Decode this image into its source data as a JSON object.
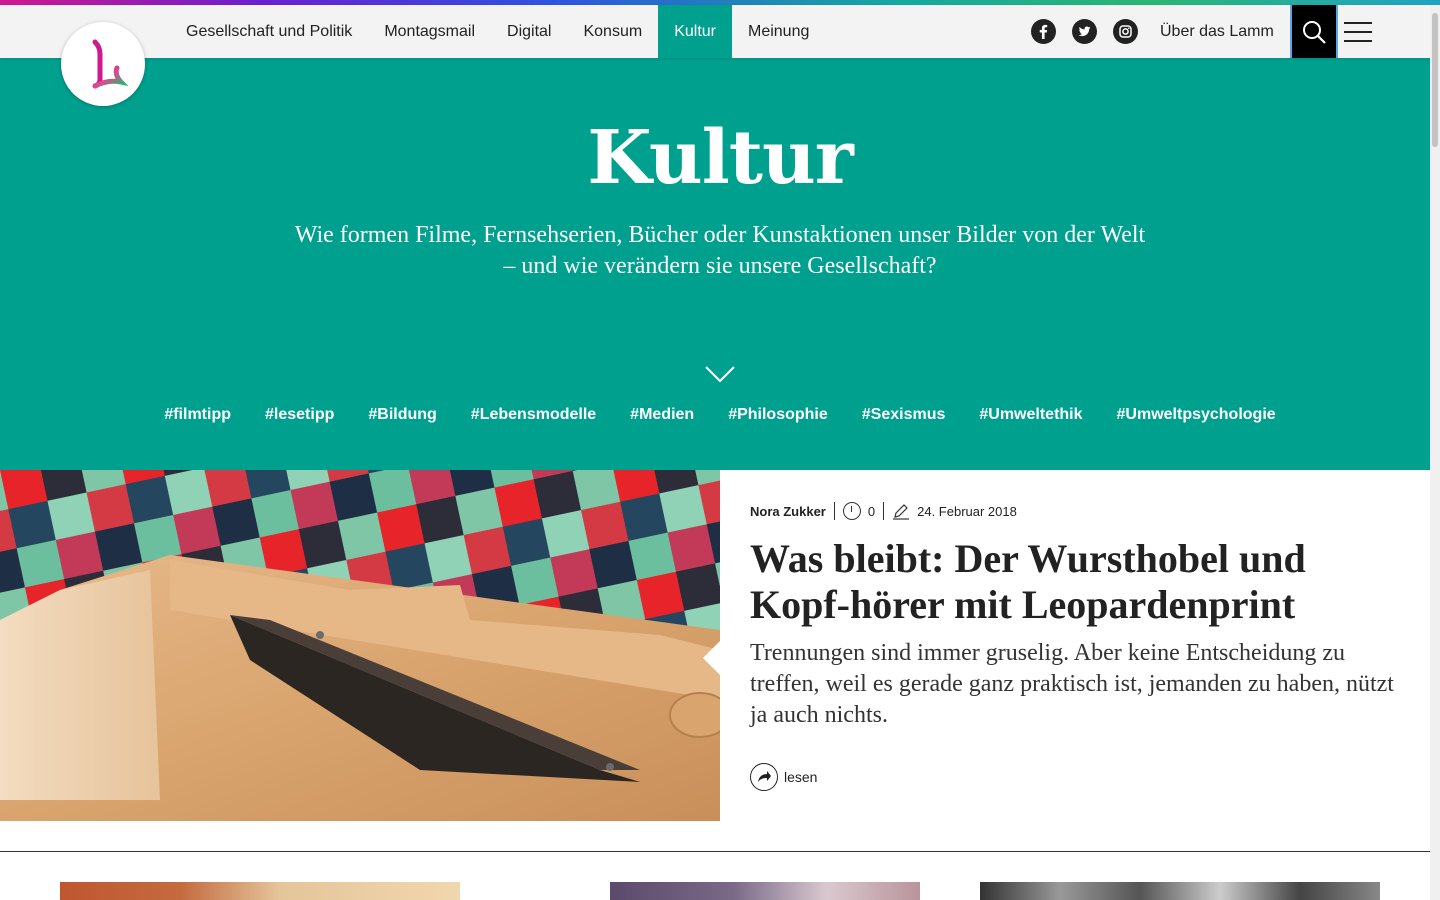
{
  "nav": {
    "items": [
      {
        "label": "Gesellschaft und Politik",
        "active": false
      },
      {
        "label": "Montagsmail",
        "active": false
      },
      {
        "label": "Digital",
        "active": false
      },
      {
        "label": "Konsum",
        "active": false
      },
      {
        "label": "Kultur",
        "active": true
      },
      {
        "label": "Meinung",
        "active": false
      }
    ],
    "about_label": "Über das Lamm",
    "social_icons": [
      "facebook-icon",
      "twitter-icon",
      "instagram-icon"
    ],
    "logo_letter": "L"
  },
  "hero": {
    "title": "Kultur",
    "subtitle_line1": "Wie formen Filme, Fernsehserien, Bücher oder Kunstaktionen unser Bilder von der Welt",
    "subtitle_line2": "– und wie verändern sie unsere Gesellschaft?",
    "tags": [
      "#filmtipp",
      "#lesetipp",
      "#Bildung",
      "#Lebensmodelle",
      "#Medien",
      "#Philosophie",
      "#Sexismus",
      "#Umweltethik",
      "#Umweltpsychologie"
    ],
    "background_color": "#00a08f"
  },
  "featured": {
    "author": "Nora Zukker",
    "comments": "0",
    "date": "24. Februar 2018",
    "title": "Was bleibt: Der Wursthobel und Kopf-hörer mit Leopardenprint",
    "excerpt": "Trennungen sind immer gruselig. Aber keine Entscheidung zu treffen, weil es gerade ganz praktisch ist, jemanden zu haben, nützt ja auch nichts.",
    "read_more": "lesen"
  }
}
